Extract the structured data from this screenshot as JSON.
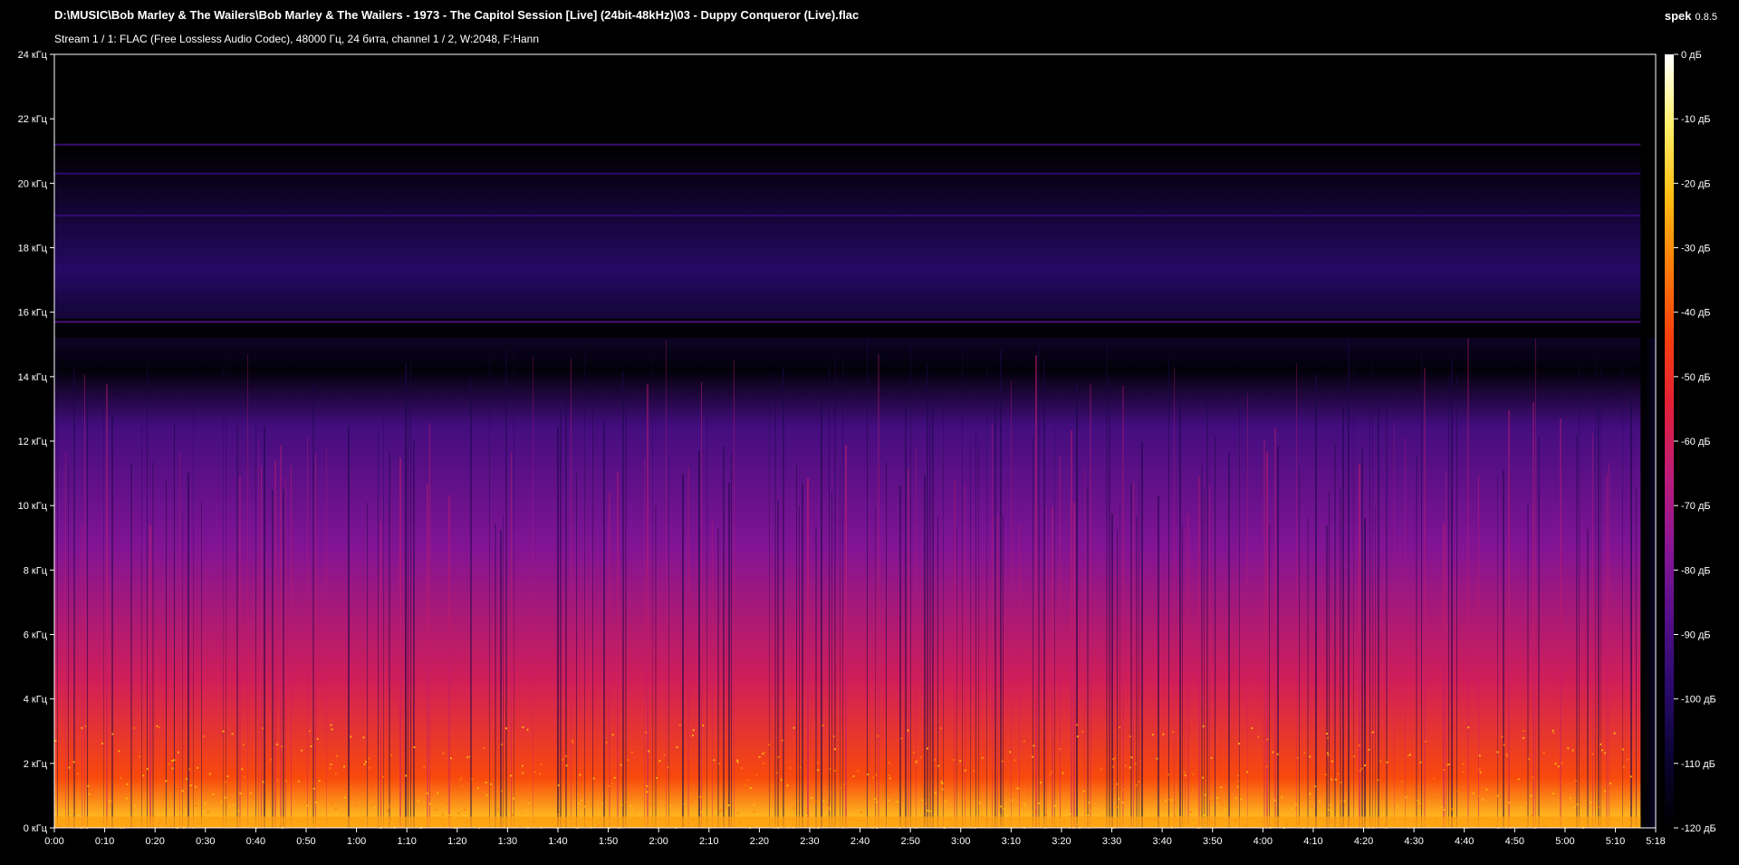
{
  "header": {
    "file_path": "D:\\MUSIC\\Bob Marley & The Wailers\\Bob Marley & The Wailers - 1973 - The Capitol Session [Live] (24bit-48kHz)\\03 - Duppy Conqueror (Live).flac",
    "stream_info": "Stream 1 / 1: FLAC (Free Lossless Audio Codec), 48000 Гц, 24 бита, channel 1 / 2, W:2048, F:Hann",
    "app_name": "spek",
    "app_version": "0.8.5"
  },
  "chart_data": {
    "type": "heatmap",
    "title": "",
    "xlabel": "",
    "ylabel": "",
    "x_range_seconds": [
      0,
      318
    ],
    "y_range_khz": [
      0,
      24
    ],
    "intensity_range_db": [
      -120,
      0
    ],
    "x_ticks": [
      "0:00",
      "0:10",
      "0:20",
      "0:30",
      "0:40",
      "0:50",
      "1:00",
      "1:10",
      "1:20",
      "1:30",
      "1:40",
      "1:50",
      "2:00",
      "2:10",
      "2:20",
      "2:30",
      "2:40",
      "2:50",
      "3:00",
      "3:10",
      "3:20",
      "3:30",
      "3:40",
      "3:50",
      "4:00",
      "4:10",
      "4:20",
      "4:30",
      "4:40",
      "4:50",
      "5:00",
      "5:10",
      "5:18"
    ],
    "y_ticks": [
      "0 кГц",
      "2 кГц",
      "4 кГц",
      "6 кГц",
      "8 кГц",
      "10 кГц",
      "12 кГц",
      "14 кГц",
      "16 кГц",
      "18 кГц",
      "20 кГц",
      "22 кГц",
      "24 кГц"
    ],
    "colorbar_ticks": [
      "0 дБ",
      "-10 дБ",
      "-20 дБ",
      "-30 дБ",
      "-40 дБ",
      "-50 дБ",
      "-60 дБ",
      "-70 дБ",
      "-80 дБ",
      "-90 дБ",
      "-100 дБ",
      "-110 дБ",
      "-120 дБ"
    ],
    "colormap": [
      "#000000",
      "#0a0432",
      "#2a0a6e",
      "#560f8a",
      "#8a1596",
      "#bd1c7a",
      "#e21f38",
      "#f7400c",
      "#fd7d09",
      "#ffbe14",
      "#fff06a",
      "#ffffff"
    ],
    "bands": [
      {
        "from_khz": 0,
        "to_khz": 0.4,
        "level_db": -20
      },
      {
        "from_khz": 0.4,
        "to_khz": 3,
        "level_db": -42
      },
      {
        "from_khz": 3,
        "to_khz": 7,
        "level_db": -60
      },
      {
        "from_khz": 7,
        "to_khz": 12,
        "level_db": -78
      },
      {
        "from_khz": 12,
        "to_khz": 15.2,
        "level_db": -92
      },
      {
        "from_khz": 15.2,
        "to_khz": 15.8,
        "level_db": -118
      },
      {
        "from_khz": 15.8,
        "to_khz": 22,
        "level_db": -100
      },
      {
        "from_khz": 22,
        "to_khz": 24,
        "level_db": -120
      }
    ],
    "lines": [
      {
        "khz": 15.7,
        "level_db": -88
      },
      {
        "khz": 21.2,
        "level_db": -92
      },
      {
        "khz": 20.3,
        "level_db": -96
      },
      {
        "khz": 19.0,
        "level_db": -96
      }
    ],
    "signal_end_seconds": 315
  }
}
